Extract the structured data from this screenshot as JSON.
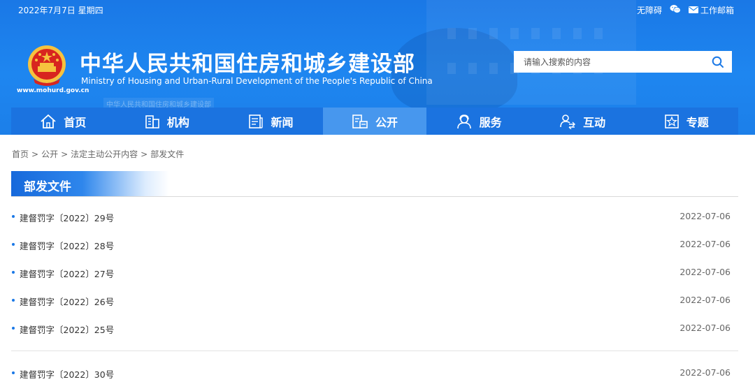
{
  "topbar": {
    "date": "2022年7月7日 星期四",
    "accessibility": "无障碍",
    "mail": "工作邮箱"
  },
  "header": {
    "site_url": "www.mohurd.gov.cn",
    "title_zh": "中华人民共和国住房和城乡建设部",
    "title_en": "Ministry of Housing and Urban-Rural Development of the People's Republic of China",
    "faint_subtitle": "中华人民共和国住房和城乡建设部"
  },
  "search": {
    "placeholder": "请输入搜索的内容"
  },
  "nav": [
    {
      "label": "首页",
      "icon": "home-icon"
    },
    {
      "label": "机构",
      "icon": "building-icon"
    },
    {
      "label": "新闻",
      "icon": "news-icon"
    },
    {
      "label": "公开",
      "icon": "disclosure-icon",
      "active": true
    },
    {
      "label": "服务",
      "icon": "service-icon"
    },
    {
      "label": "互动",
      "icon": "interaction-icon"
    },
    {
      "label": "专题",
      "icon": "topic-icon"
    }
  ],
  "breadcrumb": [
    "首页",
    "公开",
    "法定主动公开内容",
    "部发文件"
  ],
  "breadcrumb_separator": ">",
  "section": {
    "title": "部发文件"
  },
  "documents": [
    {
      "title": "建督罚字〔2022〕29号",
      "date": "2022-07-06"
    },
    {
      "title": "建督罚字〔2022〕28号",
      "date": "2022-07-06"
    },
    {
      "title": "建督罚字〔2022〕27号",
      "date": "2022-07-06"
    },
    {
      "title": "建督罚字〔2022〕26号",
      "date": "2022-07-06"
    },
    {
      "title": "建督罚字〔2022〕25号",
      "date": "2022-07-06"
    },
    {
      "title": "建督罚字〔2022〕30号",
      "date": "2022-07-06"
    }
  ],
  "colors": {
    "brand_blue": "#1e86f0",
    "nav_blue": "#1b73e0",
    "nav_active": "#4797ee",
    "bullet": "#1a78e6"
  }
}
